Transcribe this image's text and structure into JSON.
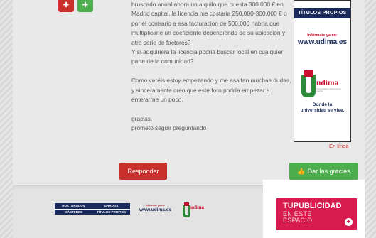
{
  "post": {
    "share_buttons": [
      {
        "icon": "share-icon",
        "color": "#c9302c"
      },
      {
        "icon": "share-icon",
        "color": "#4cae4c"
      }
    ],
    "paragraphs": [
      {
        "lines": [
          "bruscarlo anual ahora un alquilo que cuesta 300.000 € en",
          "Madrid capital, la licencia me costaria 250.000-300.000 € o",
          "por el contrario a esa facturacion de 500.000 habria que",
          "multiplicarle un coeficiente dependiendo de su ubicación y",
          "otra serie de factores?",
          "Y si adquiriera la licencia podria buscar local en cualquier",
          "parte de la comunidad?"
        ]
      },
      {
        "lines": [
          "Como veréis estoy empezando y me asaltan muchas dudas,",
          "y sinceramente creo que este foro podría empezar a",
          "enterarme un poco."
        ]
      },
      {
        "lines": [
          "gracias,",
          "prometo seguir preguntando"
        ]
      }
    ],
    "status": "En línea",
    "reply_label": "Responder",
    "thanks_label": "Dar las gracias"
  },
  "sidebar_ad": {
    "banner": "TÍTULOS PROPIOS",
    "info": "Infórmate ya en:",
    "url": "www.udima.es",
    "logo_text": "udima",
    "logo_sub": "universidad a distancia de madrid",
    "slogan_line1": "Donde la",
    "slogan_line2": "universidad se vive.",
    "colors": {
      "navy": "#1a2a5a",
      "red": "#c8102e"
    }
  },
  "footer_ad": {
    "row1_left": "DOCTORADOS",
    "row1_right": "GRADOS",
    "row2_left": "MÁSTERES",
    "row2_right": "TÍTULOS PROPIOS",
    "info": "Infórmate ya en:",
    "url": "www.udima.es",
    "logo_text": "udima"
  },
  "promo": {
    "tu": "TU",
    "publicidad": "PUBLICIDAD",
    "line2": "EN ESTE",
    "line3": "ESPACIO",
    "plus": "+",
    "color": "#d81b4f"
  }
}
